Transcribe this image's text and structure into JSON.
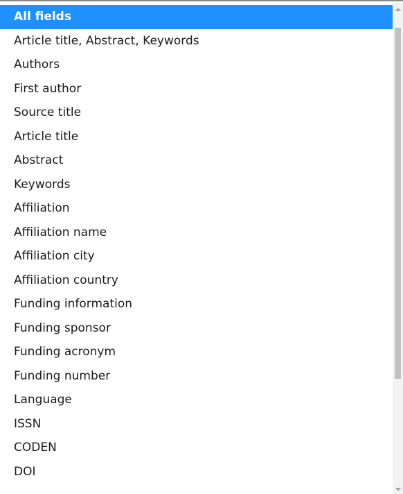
{
  "dropdown": {
    "selected_index": 0,
    "options": [
      "All fields",
      "Article title, Abstract, Keywords",
      "Authors",
      "First author",
      "Source title",
      "Article title",
      "Abstract",
      "Keywords",
      "Affiliation",
      "Affiliation name",
      "Affiliation city",
      "Affiliation country",
      "Funding information",
      "Funding sponsor",
      "Funding acronym",
      "Funding number",
      "Language",
      "ISSN",
      "CODEN",
      "DOI"
    ]
  },
  "scrollbar": {
    "up_icon": "chevron-up-icon",
    "down_icon": "chevron-down-icon"
  },
  "colors": {
    "selection_background": "#1e90ff",
    "selection_text": "#ffffff",
    "option_text": "#1a1a1a",
    "scroll_track": "#f2f2f2",
    "scroll_thumb": "#c1c1c1"
  }
}
